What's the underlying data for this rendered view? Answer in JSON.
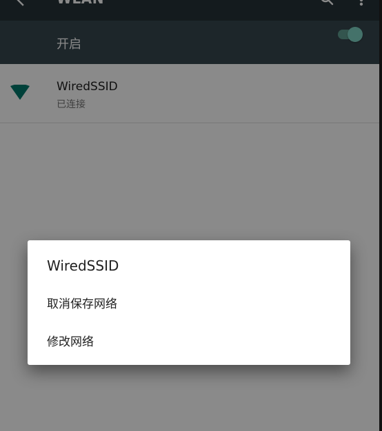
{
  "app_bar": {
    "title": "WLAN",
    "back_icon": "back-arrow-icon",
    "search_icon": "search-icon",
    "more_icon": "more-vert-icon"
  },
  "wifi_switch": {
    "label": "开启",
    "enabled": true,
    "accent": "#7fd3c5"
  },
  "wifi_list": [
    {
      "ssid": "WiredSSID",
      "status": "已连接",
      "icon": "wifi-signal-icon",
      "icon_color": "#00796b"
    }
  ],
  "dialog": {
    "title": "WiredSSID",
    "actions": [
      {
        "label": "取消保存网络"
      },
      {
        "label": "修改网络"
      }
    ]
  }
}
